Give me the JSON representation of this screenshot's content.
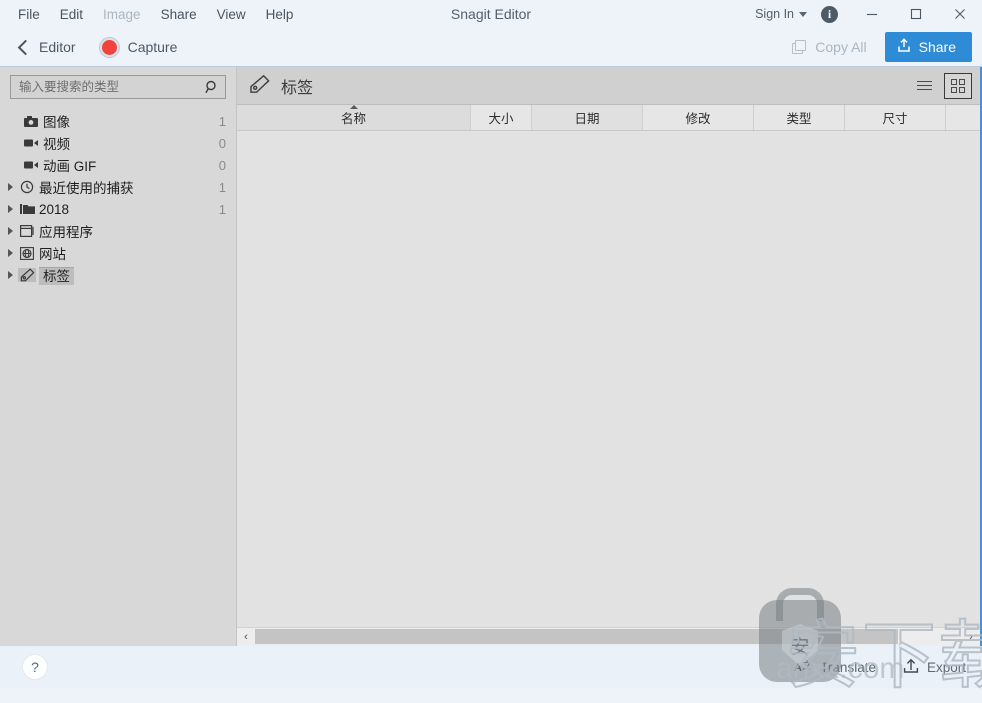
{
  "titlebar": {
    "title": "Snagit Editor",
    "menu": [
      {
        "label": "File",
        "disabled": false
      },
      {
        "label": "Edit",
        "disabled": false
      },
      {
        "label": "Image",
        "disabled": true
      },
      {
        "label": "Share",
        "disabled": false
      },
      {
        "label": "View",
        "disabled": false
      },
      {
        "label": "Help",
        "disabled": false
      }
    ],
    "sign_in": "Sign In",
    "info_glyph": "i",
    "minimize_tooltip": "Minimize",
    "maximize_tooltip": "Maximize",
    "close_tooltip": "Close"
  },
  "toolbar": {
    "back_label": "Editor",
    "capture_label": "Capture",
    "copy_all_label": "Copy All",
    "share_label": "Share",
    "accent_color": "#2e8bd6",
    "record_color": "#f0433f"
  },
  "sidebar": {
    "search": {
      "placeholder": "输入要搜索的类型",
      "value": ""
    },
    "items": [
      {
        "label": "图像",
        "count": "1",
        "icon": "camera-icon",
        "twisty": false,
        "indent": true,
        "selected": false
      },
      {
        "label": "视频",
        "count": "0",
        "icon": "video-icon",
        "twisty": false,
        "indent": true,
        "selected": false
      },
      {
        "label": "动画 GIF",
        "count": "0",
        "icon": "video-icon",
        "twisty": false,
        "indent": true,
        "selected": false
      },
      {
        "label": "最近使用的捕获",
        "count": "1",
        "icon": "clock-icon",
        "twisty": true,
        "indent": false,
        "selected": false
      },
      {
        "label": "2018",
        "count": "1",
        "icon": "folder-icon",
        "twisty": true,
        "indent": false,
        "selected": false
      },
      {
        "label": "应用程序",
        "count": "",
        "icon": "application-icon",
        "twisty": true,
        "indent": false,
        "selected": false
      },
      {
        "label": "网站",
        "count": "",
        "icon": "globe-icon",
        "twisty": true,
        "indent": false,
        "selected": false
      },
      {
        "label": "标签",
        "count": "",
        "icon": "tag-icon",
        "twisty": true,
        "indent": false,
        "selected": true
      }
    ]
  },
  "content": {
    "title": "标签",
    "title_icon": "tag-icon",
    "view_list_label": "list-view",
    "view_grid_label": "grid-view",
    "active_view": "grid",
    "columns": [
      {
        "label": "名称",
        "key": "c-name",
        "sorted": true
      },
      {
        "label": "大小",
        "key": "c-size",
        "sorted": false
      },
      {
        "label": "日期",
        "key": "c-date",
        "sorted": false
      },
      {
        "label": "修改",
        "key": "c-mod",
        "sorted": false
      },
      {
        "label": "类型",
        "key": "c-type",
        "sorted": false
      },
      {
        "label": "尺寸",
        "key": "c-dim",
        "sorted": false
      }
    ],
    "rows": [],
    "scroll_left_glyph": "‹",
    "scroll_right_glyph": "›"
  },
  "bottombar": {
    "help_glyph": "?",
    "actions": [
      {
        "label": "Translate",
        "icon": "translate-icon"
      },
      {
        "label": "Export",
        "icon": "export-icon"
      }
    ]
  },
  "watermark": {
    "badge_char": "安",
    "text": "安下载",
    "url": "anxz.com"
  }
}
